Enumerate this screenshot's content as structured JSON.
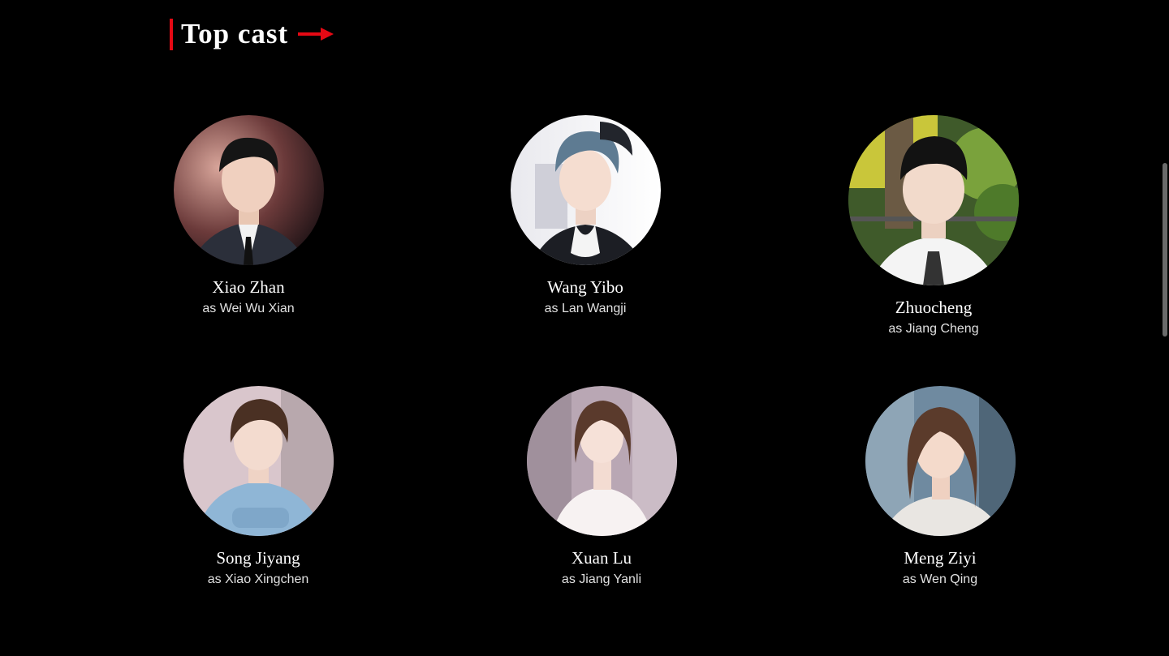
{
  "section": {
    "title": "Top cast"
  },
  "colors": {
    "accent": "#e50914",
    "background": "#000000"
  },
  "cast": [
    {
      "name": "Xiao Zhan",
      "role": "as Wei Wu Xian"
    },
    {
      "name": "Wang Yibo",
      "role": "as Lan Wangji"
    },
    {
      "name": "Zhuocheng",
      "role": "as Jiang Cheng"
    },
    {
      "name": "Song Jiyang",
      "role": "as Xiao Xingchen"
    },
    {
      "name": "Xuan Lu",
      "role": "as Jiang Yanli"
    },
    {
      "name": "Meng Ziyi",
      "role": "as Wen Qing"
    }
  ]
}
